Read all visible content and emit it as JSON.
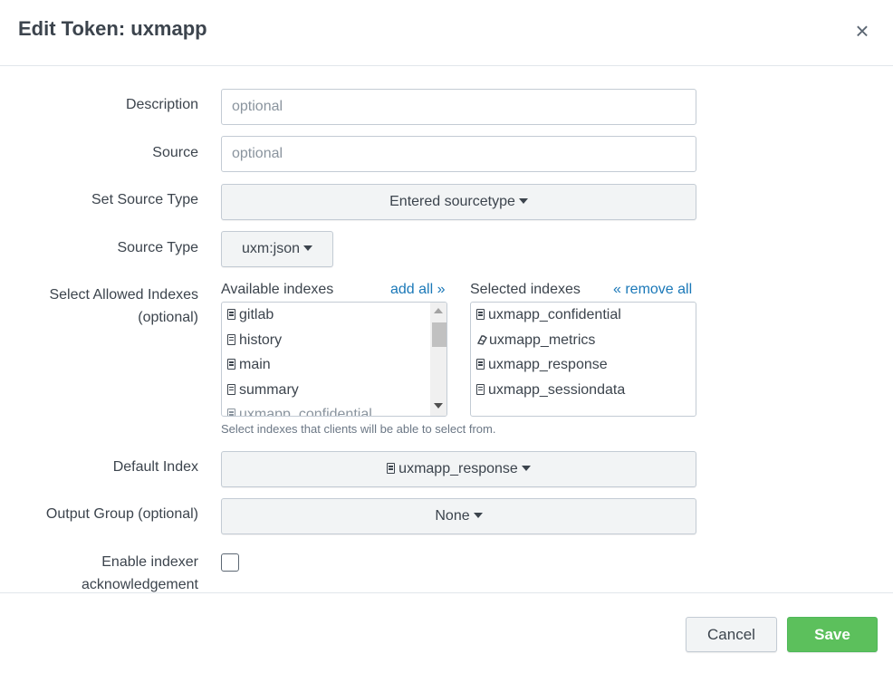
{
  "dialog": {
    "title": "Edit Token: uxmapp",
    "close_glyph": "×"
  },
  "form": {
    "description": {
      "label": "Description",
      "placeholder": "optional",
      "value": ""
    },
    "source": {
      "label": "Source",
      "placeholder": "optional",
      "value": ""
    },
    "set_source_type": {
      "label": "Set Source Type",
      "selected": "Entered sourcetype"
    },
    "source_type": {
      "label": "Source Type",
      "selected": "uxm:json"
    },
    "allowed_indexes": {
      "label": "Select Allowed Indexes",
      "label_suffix": "(optional)",
      "available_heading": "Available indexes",
      "add_all": "add all »",
      "selected_heading": "Selected indexes",
      "remove_all": "« remove all",
      "available": [
        "gitlab",
        "history",
        "main",
        "summary",
        "uxmapp_confidential"
      ],
      "selected": [
        {
          "name": "uxmapp_confidential",
          "icon": "index-icon"
        },
        {
          "name": "uxmapp_metrics",
          "icon": "metrics-icon"
        },
        {
          "name": "uxmapp_response",
          "icon": "index-icon"
        },
        {
          "name": "uxmapp_sessiondata",
          "icon": "index-icon"
        }
      ],
      "help": "Select indexes that clients will be able to select from."
    },
    "default_index": {
      "label": "Default Index",
      "selected": "uxmapp_response"
    },
    "output_group": {
      "label": "Output Group (optional)",
      "selected": "None"
    },
    "indexer_ack": {
      "label_line1": "Enable indexer",
      "label_line2": "acknowledgement",
      "checked": false
    }
  },
  "footer": {
    "cancel_label": "Cancel",
    "save_label": "Save"
  },
  "colors": {
    "link": "#1a78b8",
    "save": "#5cc05c",
    "text": "#3c444d"
  }
}
